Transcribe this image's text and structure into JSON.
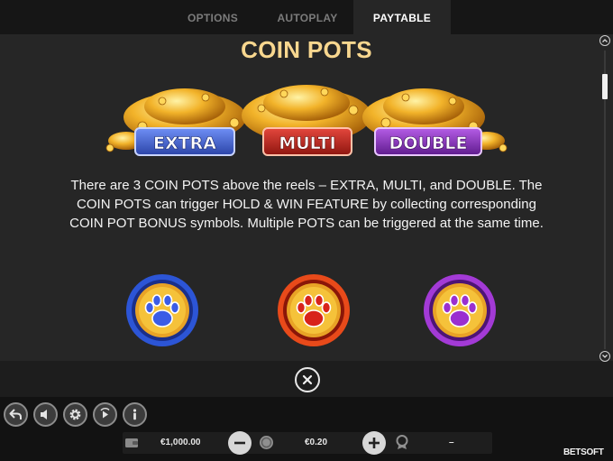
{
  "tabs": {
    "options": "OPTIONS",
    "autoplay": "AUTOPLAY",
    "paytable": "PAYTABLE",
    "active": "PAYTABLE"
  },
  "paytable": {
    "title": "COIN POTS",
    "pots": [
      "EXTRA",
      "MULTI",
      "DOUBLE"
    ],
    "description": "There are 3 COIN POTS above the reels – EXTRA, MULTI, and DOUBLE. The COIN POTS can trigger HOLD & WIN FEATURE by collecting corresponding COIN POT BONUS symbols. Multiple POTS can be triggered at the same time.",
    "symbols": [
      "blue paw coin",
      "red paw coin",
      "purple paw coin"
    ]
  },
  "footer": {
    "balance": "€1,000.00",
    "bet": "€0.20",
    "win": "–",
    "brand": "BETSOFT"
  },
  "icons": {
    "controls": [
      "back-arrow-icon",
      "sound-icon",
      "settings-gear-icon",
      "autoplay-icon",
      "info-icon"
    ],
    "wallet": "wallet-icon",
    "coins": "coins-icon",
    "trophy": "award-icon"
  },
  "colors": {
    "title": "#f8d78f",
    "extra": "#3f63d8",
    "multi": "#c8261f",
    "double": "#8a2fc4",
    "coin": "#f2b32a"
  }
}
